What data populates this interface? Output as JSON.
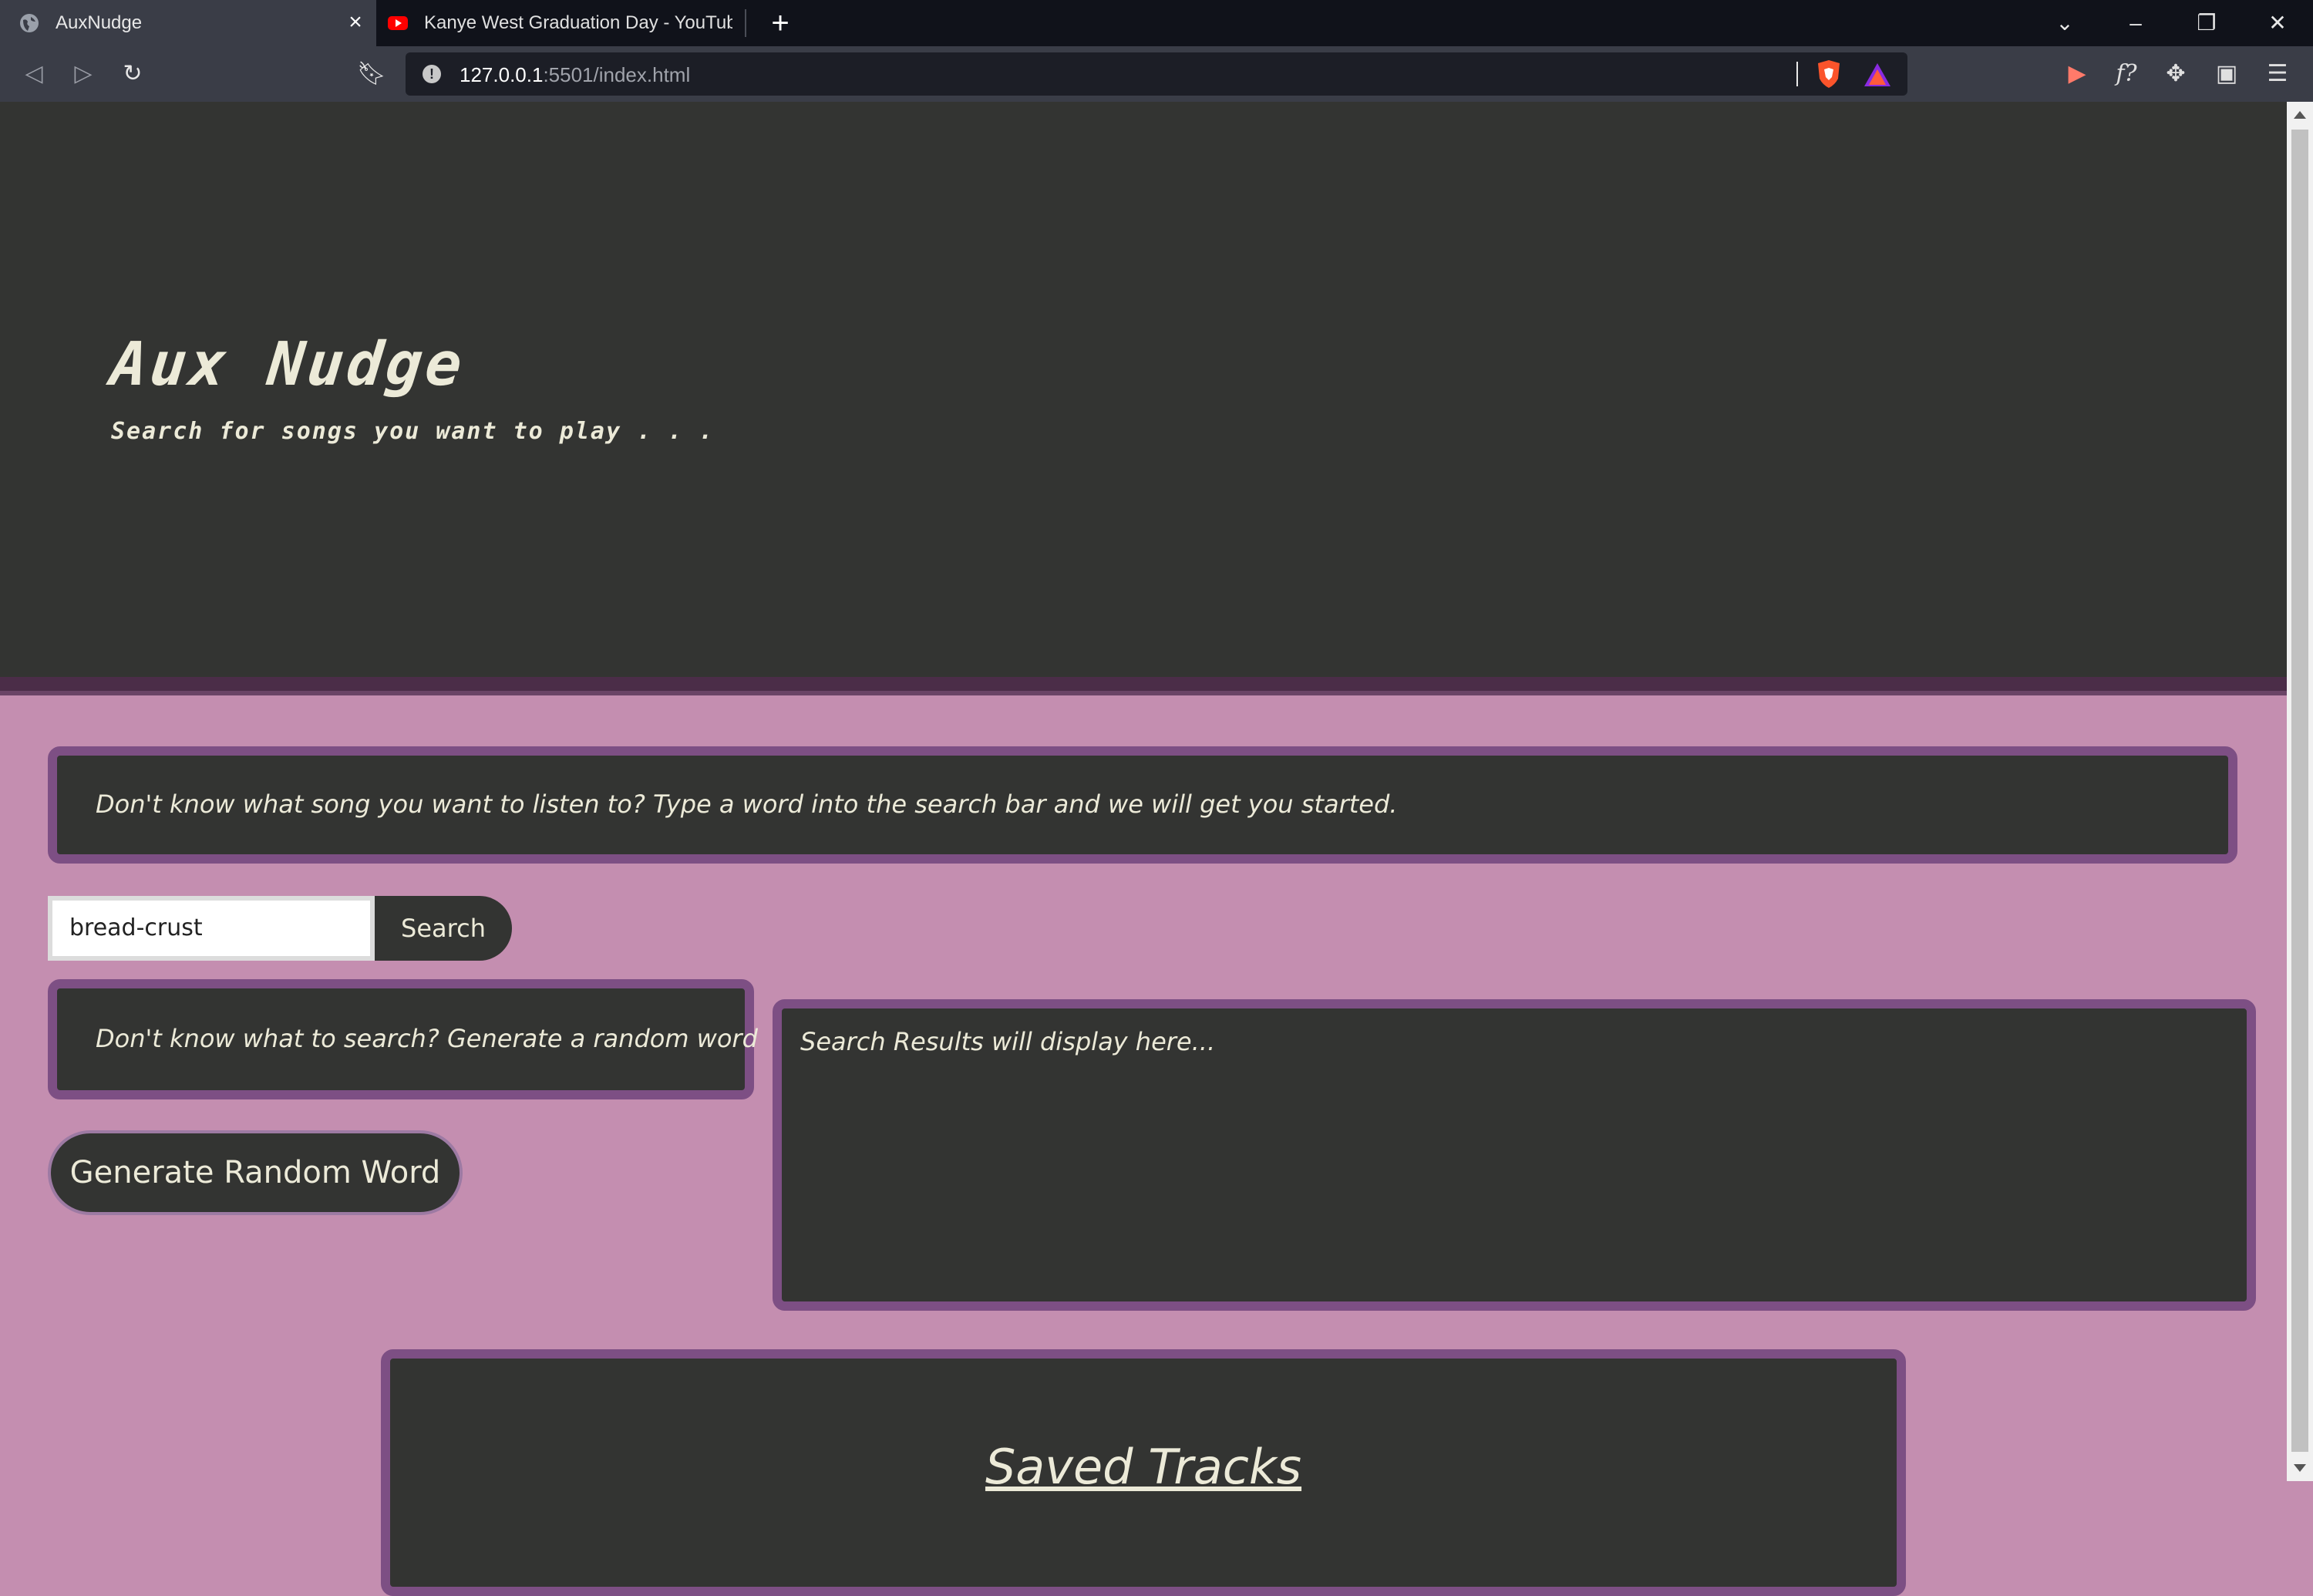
{
  "browser": {
    "tabs": [
      {
        "title": "AuxNudge",
        "active": true
      },
      {
        "title": "Kanye West Graduation Day - YouTube",
        "active": false
      }
    ],
    "url_host": "127.0.0.1",
    "url_rest": ":5501/index.html"
  },
  "hero": {
    "title": "Aux Nudge",
    "subtitle": "Search for songs you want to play . . ."
  },
  "intro": {
    "text": "Don't know what song you want to listen to? Type a word into the search bar and we will get you started."
  },
  "search": {
    "value": "bread-crust",
    "button_label": "Search"
  },
  "random": {
    "hint": "Don't know what to search? Generate a random word",
    "button_label": "Generate Random Word"
  },
  "results": {
    "placeholder": "Search Results will display here..."
  },
  "saved": {
    "title": "Saved Tracks"
  },
  "colors": {
    "page_bg": "#c48eb0",
    "panel_bg": "#333432",
    "panel_border": "#7d4f84",
    "text": "#ecead8"
  }
}
